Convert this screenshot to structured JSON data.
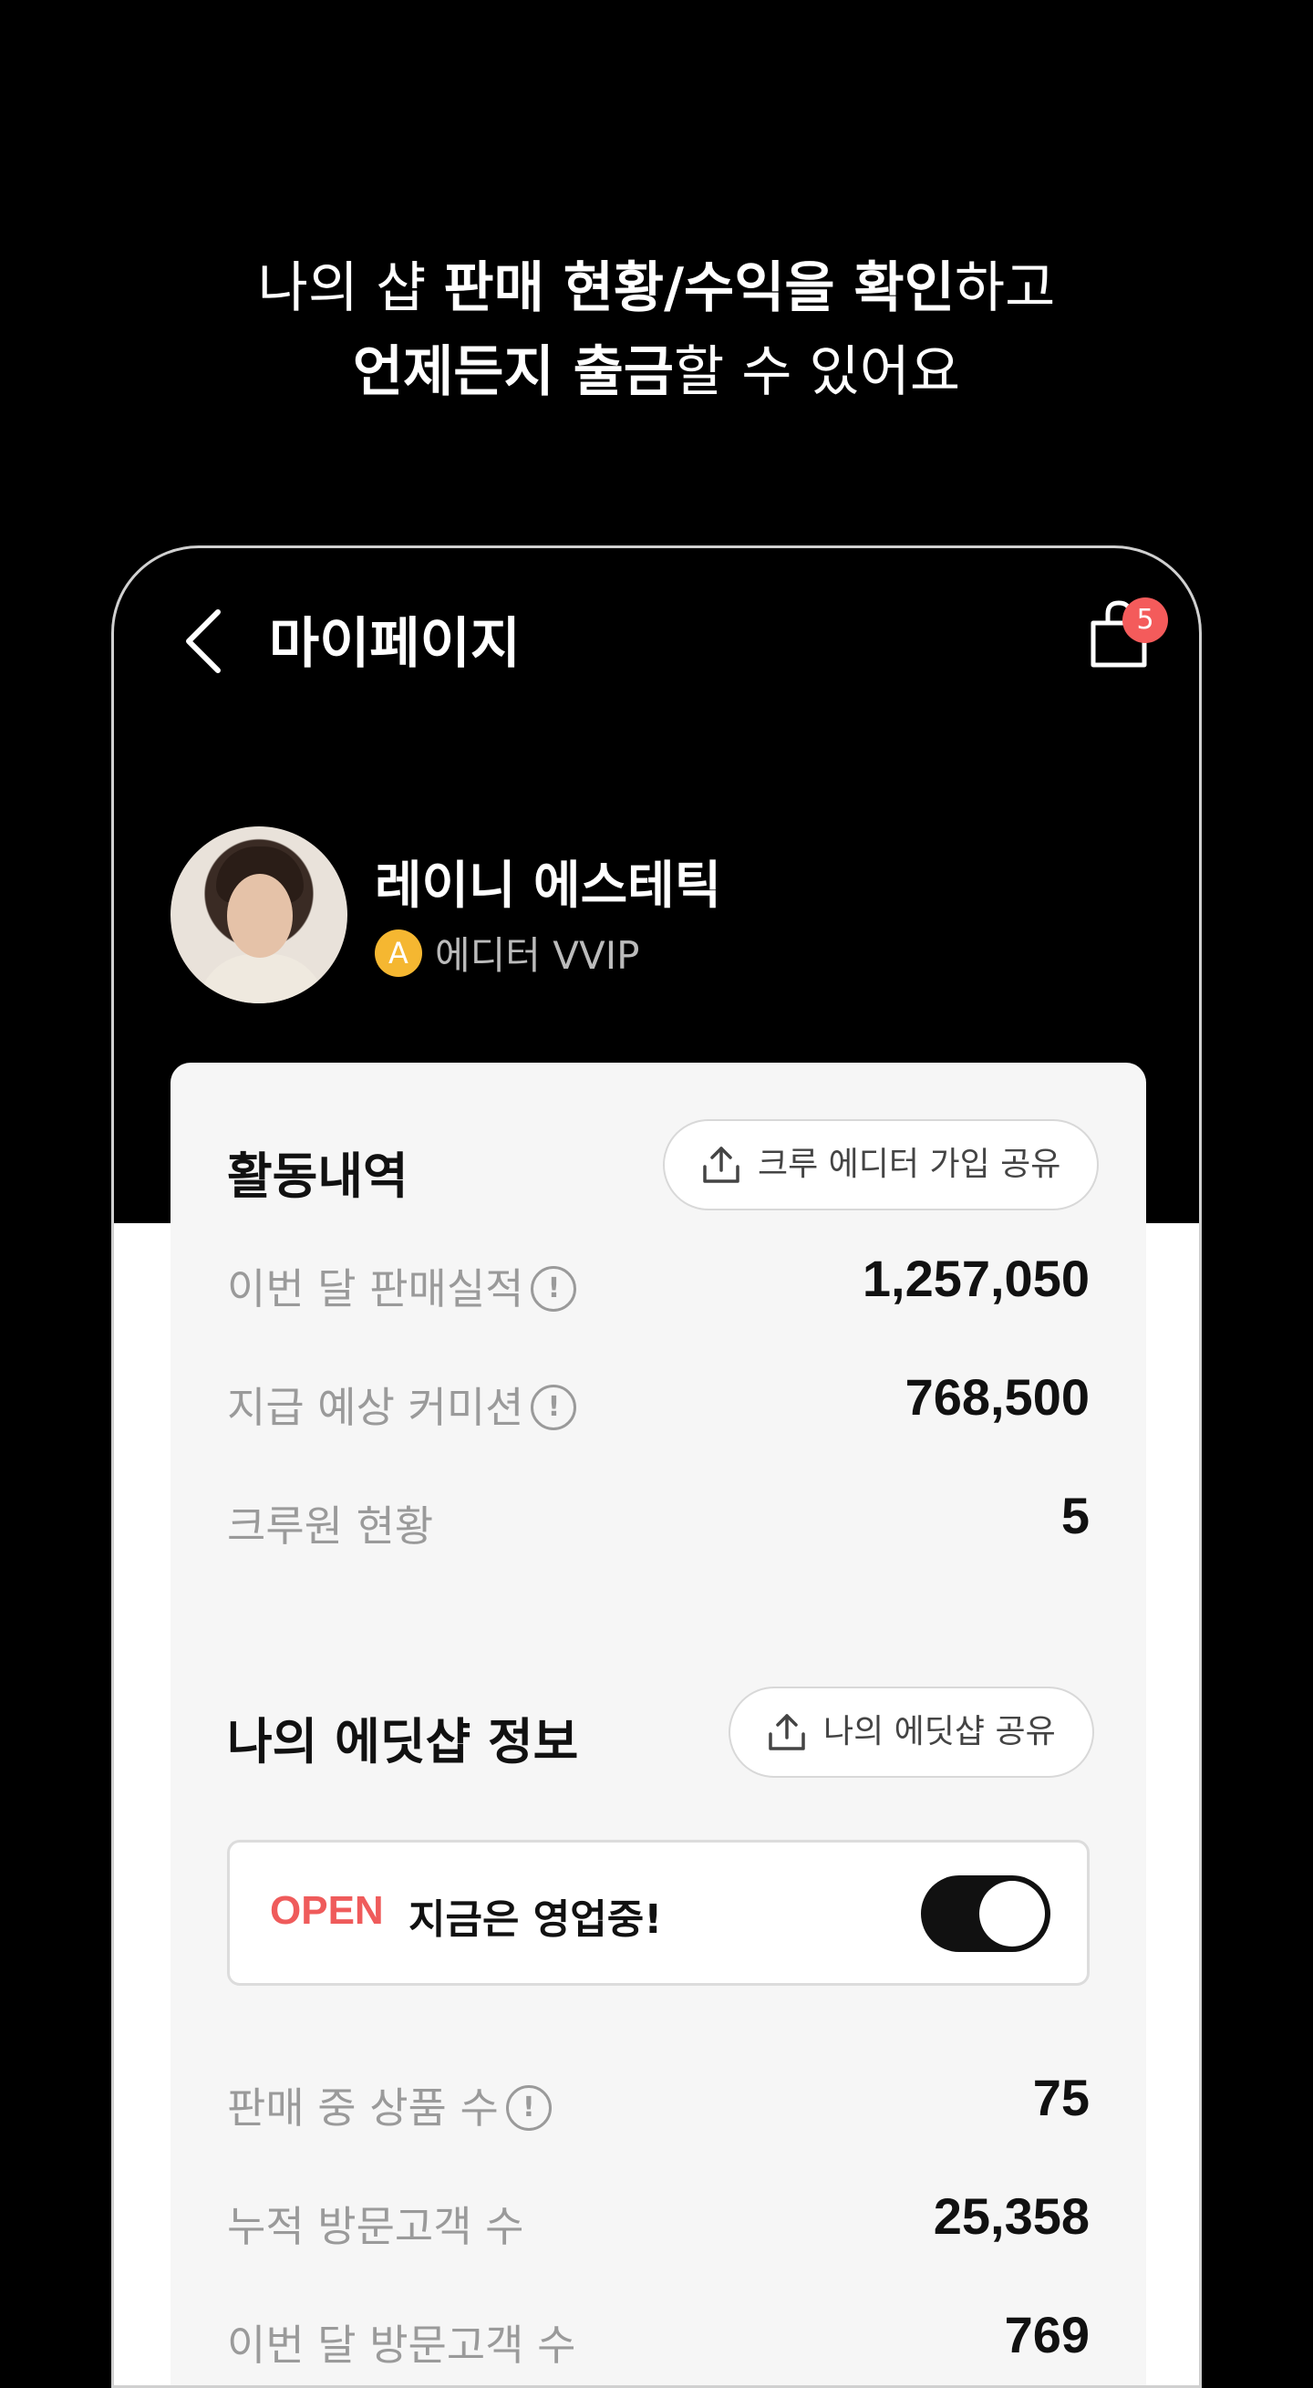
{
  "promo": {
    "line1_part1": "나의 샵 ",
    "line1_bold": "판매 현황/수익을 확인",
    "line1_part2": "하고",
    "line2_bold": "언제든지 출금",
    "line2_part2": "할 수 있어요"
  },
  "header": {
    "title": "마이페이지",
    "back_icon": "chevron-left-icon",
    "bag_icon": "shopping-bag-icon",
    "cart_count": "5"
  },
  "profile": {
    "name": "레이니 에스테틱",
    "grade_icon_letter": "A",
    "grade": "에디터 VVIP"
  },
  "activity": {
    "title": "활동내역",
    "share_button": "크루 에디터 가입 공유",
    "rows": [
      {
        "label": "이번 달 판매실적",
        "value": "1,257,050",
        "info": true
      },
      {
        "label": "지급 예상 커미션",
        "value": "768,500",
        "info": true
      },
      {
        "label": "크루원 현황",
        "value": "5",
        "info": false
      }
    ]
  },
  "shop": {
    "title": "나의 에딧샵 정보",
    "share_button": "나의 에딧샵 공유",
    "status_tag": "OPEN",
    "status_text": "지금은 영업중!",
    "toggle_on": true,
    "rows": [
      {
        "label": "판매 중 상품 수",
        "value": "75",
        "info": true
      },
      {
        "label": "누적 방문고객 수",
        "value": "25,358",
        "info": false
      },
      {
        "label": "이번 달 방문고객 수",
        "value": "769",
        "info": false
      }
    ]
  },
  "colors": {
    "background": "#000000",
    "badge": "#f45b5b",
    "open": "#ef5b5b",
    "grade": "#f5b731",
    "card": "#f6f6f6"
  }
}
